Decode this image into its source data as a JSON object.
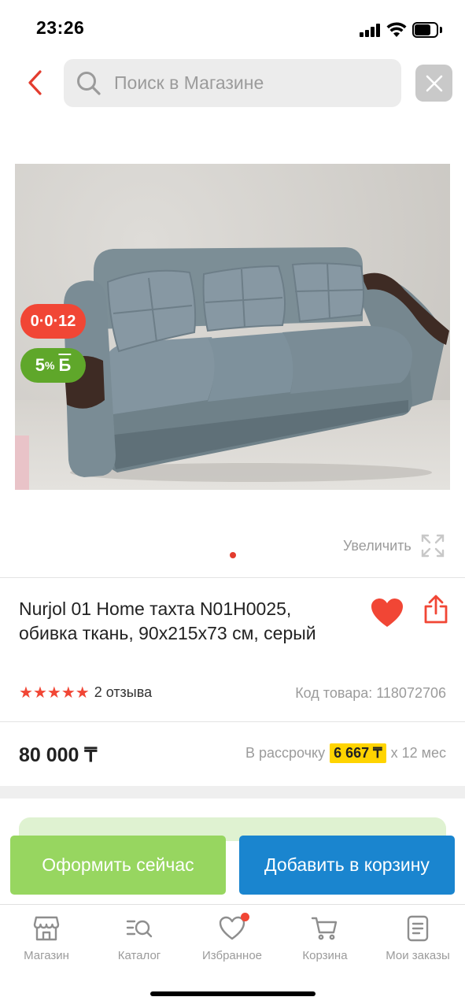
{
  "status_bar": {
    "time": "23:26"
  },
  "header": {
    "search_placeholder": "Поиск в Магазине"
  },
  "gallery": {
    "badge_installment": "0·0·12",
    "badge_bonus_value": "5",
    "badge_bonus_sign": "%",
    "badge_bonus_letter": "Б",
    "zoom_label": "Увеличить"
  },
  "product": {
    "title": "Nurjol 01 Home тахта N01H0025, обивка ткань, 90x215x73 см, серый",
    "rating_stars": 5,
    "reviews": "2 отзыва",
    "code": "Код товара: 118072706",
    "price": "80 000 ₸",
    "installment_prefix": "В рассрочку",
    "installment_amount": "6 667 ₸",
    "installment_suffix": "x 12 мес"
  },
  "actions": {
    "buy_now": "Оформить сейчас",
    "add_to_cart": "Добавить в корзину"
  },
  "tab_bar": {
    "items": [
      {
        "label": "Магазин",
        "icon": "shop-icon"
      },
      {
        "label": "Каталог",
        "icon": "catalog-search-icon"
      },
      {
        "label": "Избранное",
        "icon": "heart-icon"
      },
      {
        "label": "Корзина",
        "icon": "cart-icon"
      },
      {
        "label": "Мои заказы",
        "icon": "orders-icon"
      }
    ]
  },
  "colors": {
    "accent_red": "#f14635",
    "buy_now_green": "#97d660",
    "cart_blue": "#1a85cf",
    "installment_yellow": "#ffd400"
  }
}
